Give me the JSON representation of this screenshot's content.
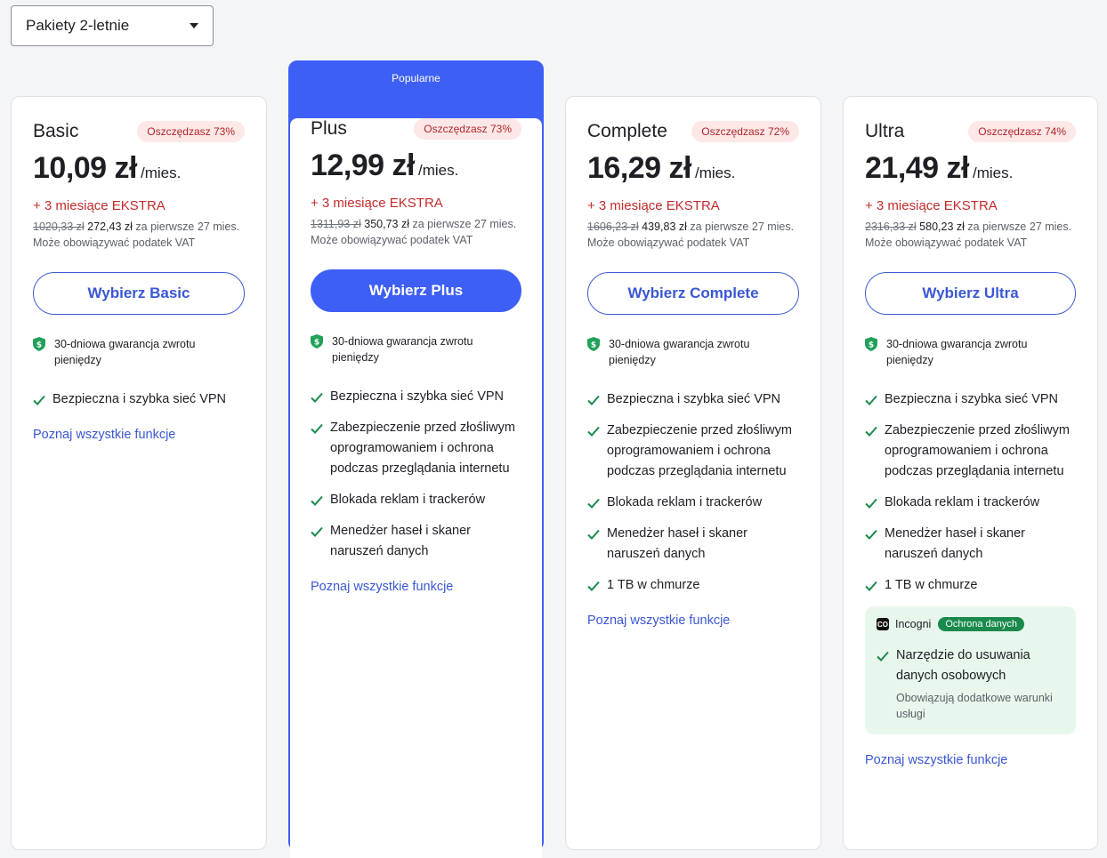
{
  "selector": {
    "value": "Pakiety 2-letnie"
  },
  "popular_label": "Popularne",
  "common": {
    "per": "/mies.",
    "extra": "+ 3 miesiące EKSTRA",
    "first_period": "za pierwsze 27 mies.",
    "vat": "Może obowiązywać podatek VAT",
    "guarantee": "30-dniowa gwarancja zwrotu pieniędzy",
    "all_features_link": "Poznaj wszystkie funkcje"
  },
  "plans": [
    {
      "name": "Basic",
      "save": "Oszczędzasz 73%",
      "price": "10,09 zł",
      "old_price": "1020,33 zł",
      "new_total": "272,43 zł",
      "cta": "Wybierz Basic",
      "features": [
        "Bezpieczna i szybka sieć VPN"
      ]
    },
    {
      "name": "Plus",
      "save": "Oszczędzasz 73%",
      "price": "12,99 zł",
      "old_price": "1311,93 zł",
      "new_total": "350,73 zł",
      "cta": "Wybierz Plus",
      "features": [
        "Bezpieczna i szybka sieć VPN",
        "Zabezpieczenie przed złośliwym oprogramowaniem i ochrona podczas przeglądania internetu",
        "Blokada reklam i trackerów",
        "Menedżer haseł i skaner naruszeń danych"
      ]
    },
    {
      "name": "Complete",
      "save": "Oszczędzasz 72%",
      "price": "16,29 zł",
      "old_price": "1606,23 zł",
      "new_total": "439,83 zł",
      "cta": "Wybierz Complete",
      "features": [
        "Bezpieczna i szybka sieć VPN",
        "Zabezpieczenie przed złośliwym oprogramowaniem i ochrona podczas przeglądania internetu",
        "Blokada reklam i trackerów",
        "Menedżer haseł i skaner naruszeń danych",
        "1 TB w chmurze"
      ]
    },
    {
      "name": "Ultra",
      "save": "Oszczędzasz 74%",
      "price": "21,49 zł",
      "old_price": "2316,33 zł",
      "new_total": "580,23 zł",
      "cta": "Wybierz Ultra",
      "features": [
        "Bezpieczna i szybka sieć VPN",
        "Zabezpieczenie przed złośliwym oprogramowaniem i ochrona podczas przeglądania internetu",
        "Blokada reklam i trackerów",
        "Menedżer haseł i skaner naruszeń danych",
        "1 TB w chmurze"
      ],
      "incogni": {
        "logo_text": "CO",
        "name": "Incogni",
        "badge": "Ochrona danych",
        "feature": "Narzędzie do usuwania danych osobowych",
        "note": "Obowiązują dodatkowe warunki usługi"
      }
    }
  ],
  "colors": {
    "accent": "#3e5ff5",
    "save_bg": "#fde7e7",
    "save_text": "#b0262b",
    "extra": "#c52b2b",
    "check": "#1a8a4c"
  }
}
